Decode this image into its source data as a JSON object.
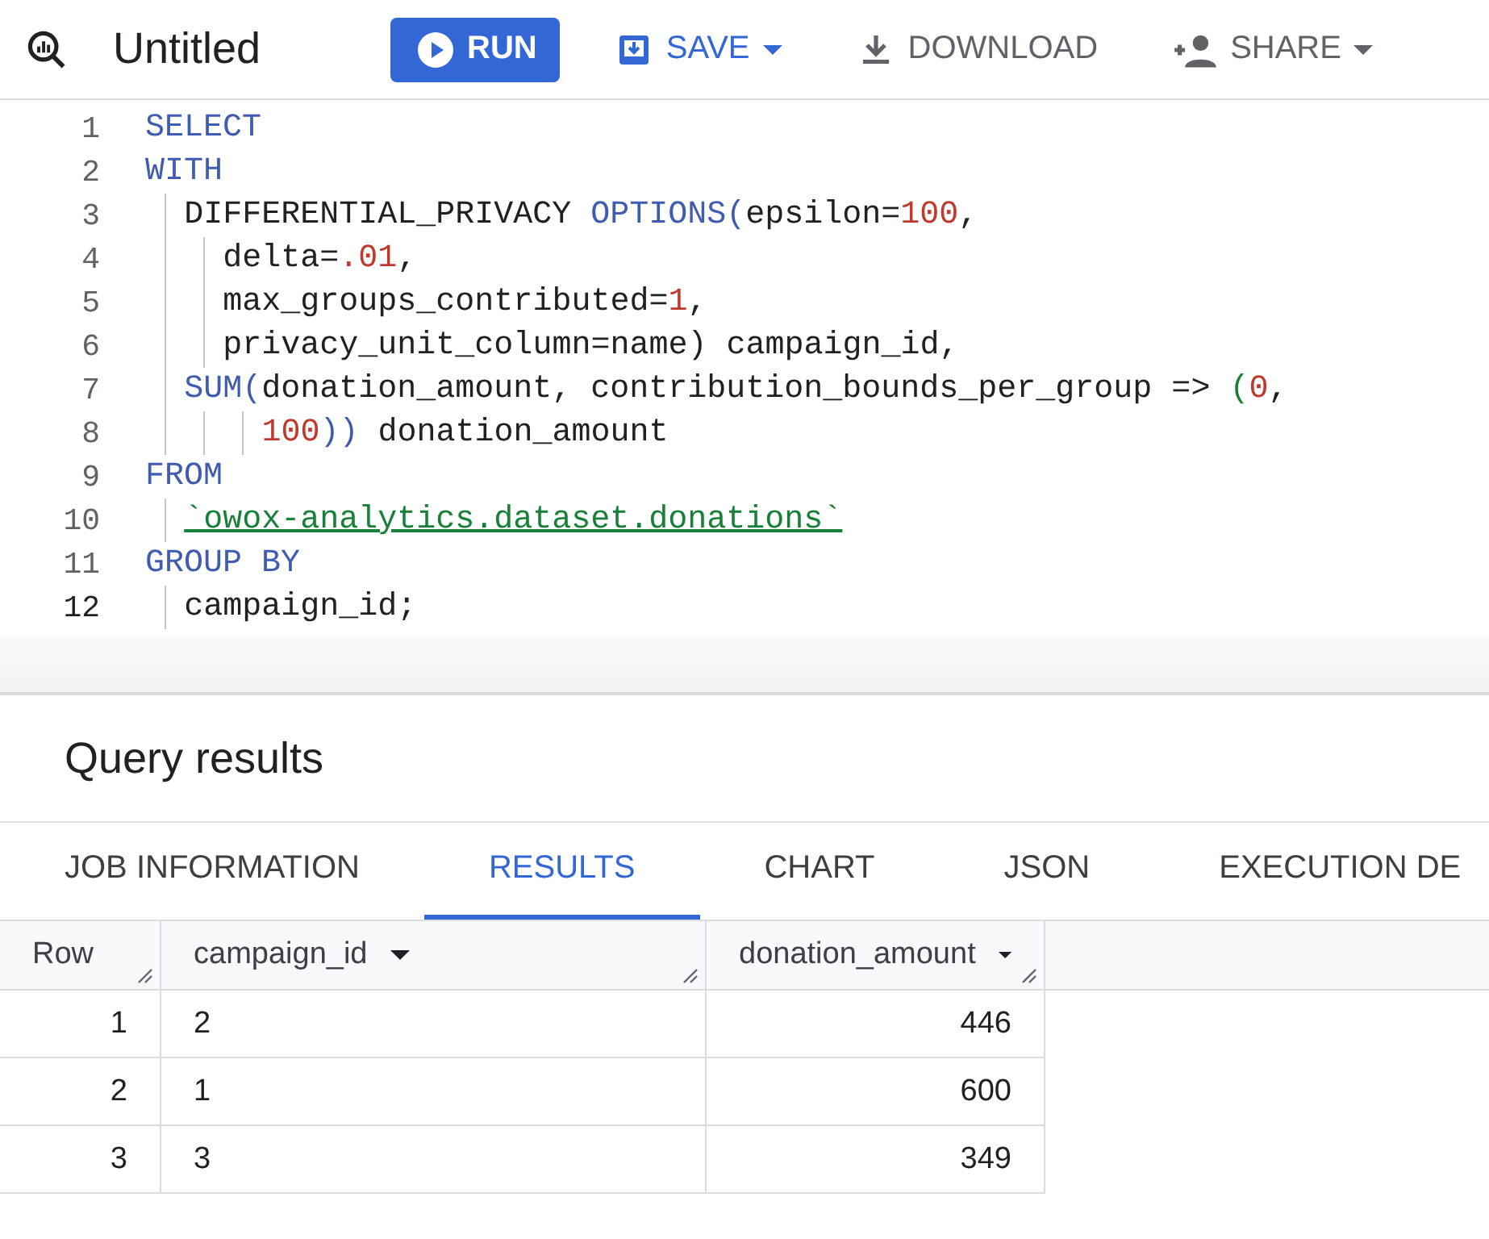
{
  "toolbar": {
    "title": "Untitled",
    "buttons": [
      {
        "kind": "run",
        "label": "RUN",
        "dropdown": false
      },
      {
        "kind": "save",
        "label": "SAVE",
        "dropdown": true
      },
      {
        "kind": "download",
        "label": "DOWNLOAD",
        "dropdown": false
      },
      {
        "kind": "share",
        "label": "SHARE",
        "dropdown": true
      }
    ]
  },
  "editor": {
    "lines": [
      {
        "number": "1",
        "active": false,
        "tokens": [
          {
            "kind": "keyword",
            "text": "SELECT"
          }
        ]
      },
      {
        "number": "2",
        "active": false,
        "tokens": [
          {
            "kind": "keyword",
            "text": "WITH"
          }
        ]
      },
      {
        "number": "3",
        "active": false,
        "tokens": [
          {
            "kind": "plain",
            "text": "  DIFFERENTIAL_PRIVACY "
          },
          {
            "kind": "keyword",
            "text": "OPTIONS("
          },
          {
            "kind": "plain",
            "text": "epsilon="
          },
          {
            "kind": "number",
            "text": "100"
          },
          {
            "kind": "plain",
            "text": ","
          }
        ]
      },
      {
        "number": "4",
        "active": false,
        "tokens": [
          {
            "kind": "plain",
            "text": "    delta="
          },
          {
            "kind": "number",
            "text": ".01"
          },
          {
            "kind": "plain",
            "text": ","
          }
        ]
      },
      {
        "number": "5",
        "active": false,
        "tokens": [
          {
            "kind": "plain",
            "text": "    max_groups_contributed="
          },
          {
            "kind": "number",
            "text": "1"
          },
          {
            "kind": "plain",
            "text": ","
          }
        ]
      },
      {
        "number": "6",
        "active": false,
        "tokens": [
          {
            "kind": "plain",
            "text": "    privacy_unit_column=name) campaign_id,"
          }
        ]
      },
      {
        "number": "7",
        "active": false,
        "tokens": [
          {
            "kind": "keyword",
            "text": "  SUM("
          },
          {
            "kind": "plain",
            "text": "donation_amount, contribution_bounds_per_group => "
          },
          {
            "kind": "paren",
            "text": "("
          },
          {
            "kind": "number",
            "text": "0"
          },
          {
            "kind": "plain",
            "text": ","
          }
        ]
      },
      {
        "number": "8",
        "active": false,
        "tokens": [
          {
            "kind": "number",
            "text": "      100"
          },
          {
            "kind": "keyword",
            "text": "))"
          },
          {
            "kind": "plain",
            "text": " donation_amount"
          }
        ]
      },
      {
        "number": "9",
        "active": false,
        "tokens": [
          {
            "kind": "keyword",
            "text": "FROM"
          }
        ]
      },
      {
        "number": "10",
        "active": false,
        "tokens": [
          {
            "kind": "string",
            "text": "  `owox-analytics.dataset.donations`"
          }
        ]
      },
      {
        "number": "11",
        "active": false,
        "tokens": [
          {
            "kind": "keyword",
            "text": "GROUP BY"
          }
        ]
      },
      {
        "number": "12",
        "active": true,
        "tokens": [
          {
            "kind": "plain",
            "text": "  campaign_id;"
          }
        ]
      }
    ]
  },
  "results": {
    "title": "Query results",
    "tabs": [
      {
        "label": "JOB INFORMATION",
        "selected": false
      },
      {
        "label": "RESULTS",
        "selected": true
      },
      {
        "label": "CHART",
        "selected": false
      },
      {
        "label": "JSON",
        "selected": false
      },
      {
        "label": "EXECUTION DE",
        "selected": false
      }
    ],
    "table": {
      "columns": [
        {
          "label": "Row",
          "sortable": false,
          "kind": "index"
        },
        {
          "label": "campaign_id",
          "sortable": true,
          "kind": "text"
        },
        {
          "label": "donation_amount",
          "sortable": true,
          "kind": "number"
        }
      ],
      "rows": [
        [
          "1",
          "2",
          "446"
        ],
        [
          "2",
          "1",
          "600"
        ],
        [
          "3",
          "3",
          "349"
        ]
      ]
    }
  }
}
